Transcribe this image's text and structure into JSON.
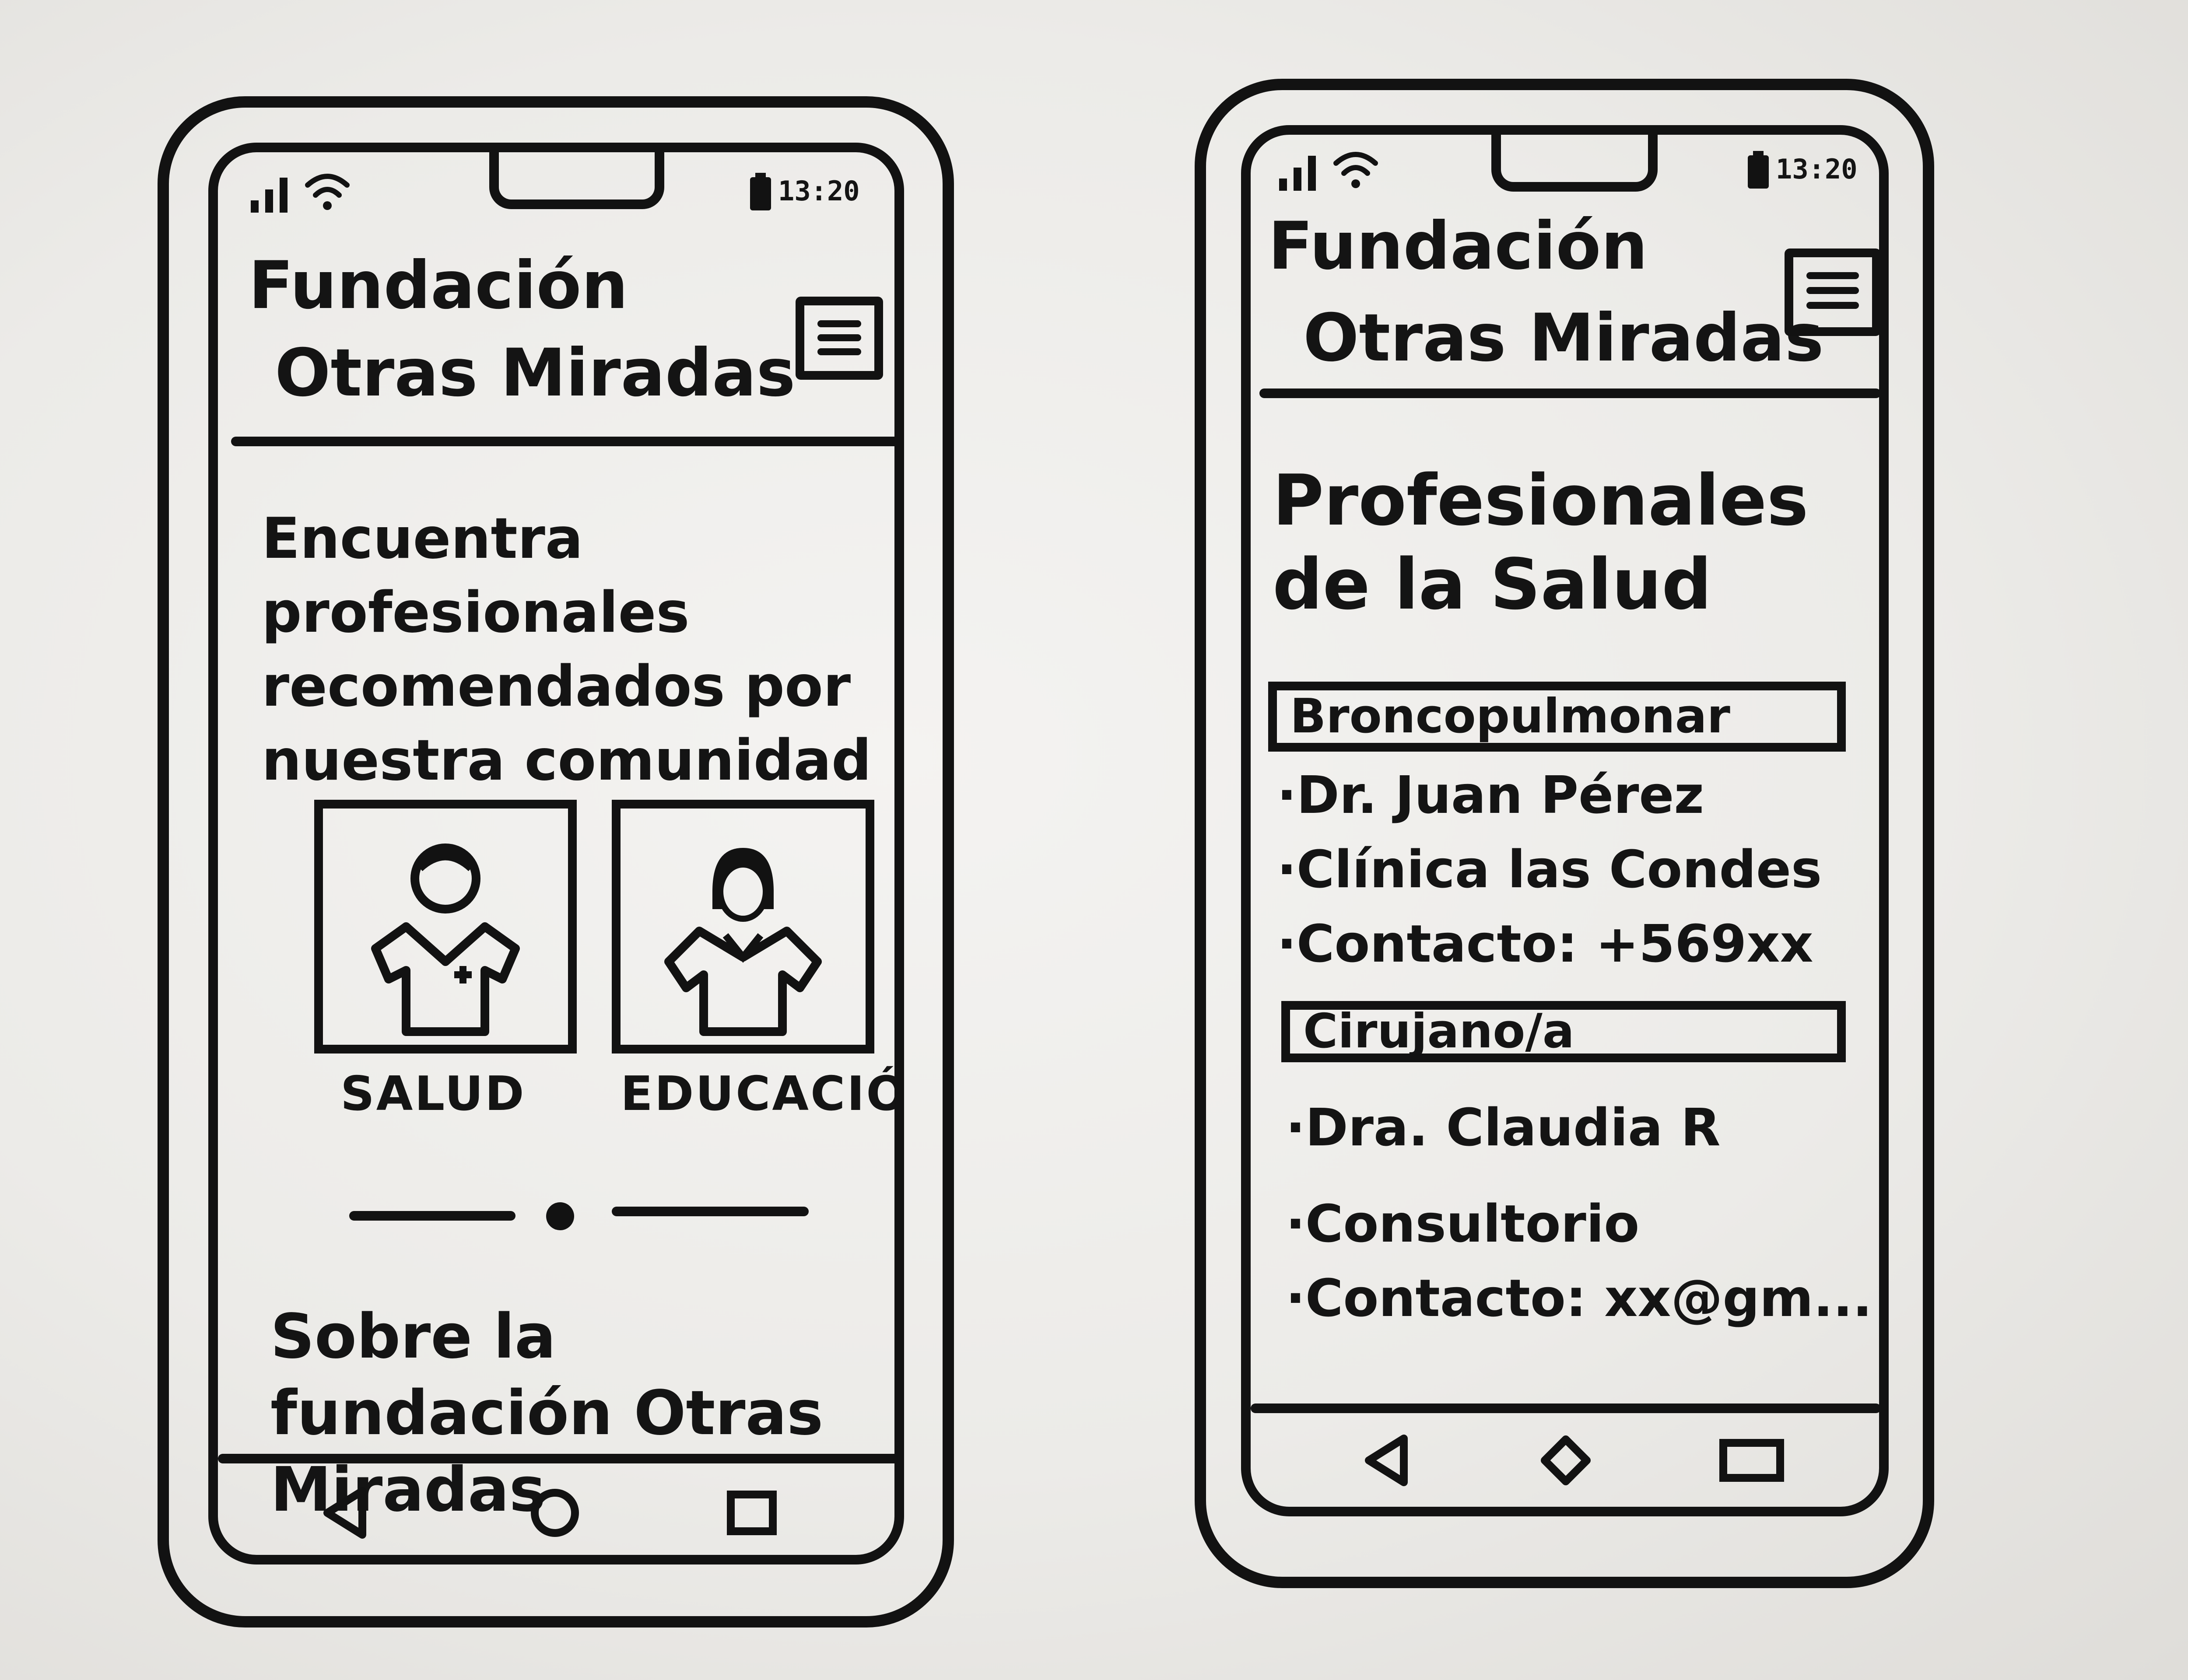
{
  "left_screen": {
    "status_time": "13:20",
    "header": {
      "title_line1": "Fundación",
      "title_line2": "Otras Miradas",
      "menu_icon": "menu-icon"
    },
    "hero_text": "Encuentra profesionales recomendados por nuestra comunidad",
    "categories": [
      {
        "label": "SALUD",
        "icon": "doctor-icon"
      },
      {
        "label": "EDUCACIÓN",
        "icon": "teacher-icon"
      }
    ],
    "about_text": "Sobre la fundación Otras Miradas",
    "nav": [
      "back-icon",
      "home-icon",
      "recents-icon"
    ]
  },
  "right_screen": {
    "status_time": "13:20",
    "header": {
      "title_line1": "Fundación",
      "title_line2": "Otras Miradas",
      "menu_icon": "menu-icon"
    },
    "page_title": "Profesionales de la Salud",
    "sections": [
      {
        "name": "Broncopulmonar",
        "items": [
          "·Dr. Juan Pérez",
          "·Clínica las Condes",
          "·Contacto: +569xx"
        ]
      },
      {
        "name": "Cirujano/a",
        "items": [
          "·Dra. Claudia R",
          "·Consultorio",
          "·Contacto: xx@gm..."
        ]
      }
    ],
    "nav": [
      "back-icon",
      "home-icon",
      "recents-icon"
    ]
  },
  "colors": {
    "ink": "#121212",
    "paper": "#f1f0ee"
  }
}
